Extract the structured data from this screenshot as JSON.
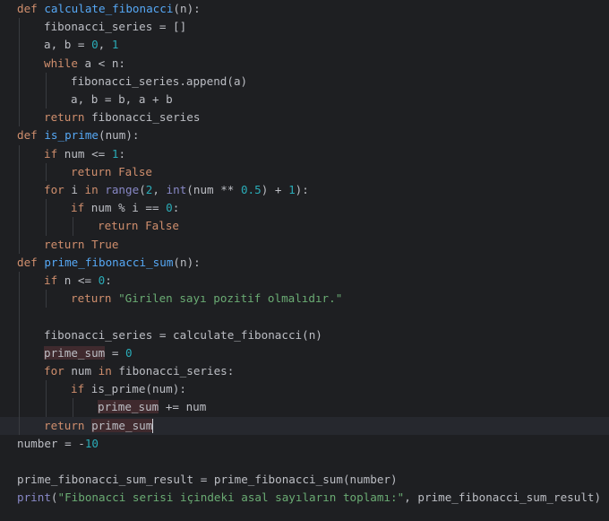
{
  "editor": {
    "lines": [
      {
        "indent": 0,
        "tokens": [
          {
            "t": "def",
            "c": "kw"
          },
          {
            "t": " "
          },
          {
            "t": "calculate_fibonacci",
            "c": "fn"
          },
          {
            "t": "(n):"
          }
        ]
      },
      {
        "indent": 1,
        "tokens": [
          {
            "t": "fibonacci_series = []"
          }
        ]
      },
      {
        "indent": 1,
        "tokens": [
          {
            "t": "a, b = "
          },
          {
            "t": "0",
            "c": "num"
          },
          {
            "t": ", "
          },
          {
            "t": "1",
            "c": "num"
          }
        ]
      },
      {
        "indent": 1,
        "tokens": [
          {
            "t": "while",
            "c": "kw"
          },
          {
            "t": " a < n:"
          }
        ]
      },
      {
        "indent": 2,
        "tokens": [
          {
            "t": "fibonacci_series.append(a)"
          }
        ]
      },
      {
        "indent": 2,
        "tokens": [
          {
            "t": "a, b = b, a + b"
          }
        ]
      },
      {
        "indent": 1,
        "tokens": [
          {
            "t": "return",
            "c": "kw"
          },
          {
            "t": " fibonacci_series"
          }
        ]
      },
      {
        "indent": 0,
        "tokens": [
          {
            "t": "def",
            "c": "kw"
          },
          {
            "t": " "
          },
          {
            "t": "is_prime",
            "c": "fn"
          },
          {
            "t": "(num):"
          }
        ]
      },
      {
        "indent": 1,
        "tokens": [
          {
            "t": "if",
            "c": "kw"
          },
          {
            "t": " num <= "
          },
          {
            "t": "1",
            "c": "num"
          },
          {
            "t": ":"
          }
        ]
      },
      {
        "indent": 2,
        "tokens": [
          {
            "t": "return",
            "c": "kw"
          },
          {
            "t": " "
          },
          {
            "t": "False",
            "c": "kw"
          }
        ]
      },
      {
        "indent": 1,
        "tokens": [
          {
            "t": "for",
            "c": "kw"
          },
          {
            "t": " i "
          },
          {
            "t": "in",
            "c": "kw"
          },
          {
            "t": " "
          },
          {
            "t": "range",
            "c": "builtin"
          },
          {
            "t": "("
          },
          {
            "t": "2",
            "c": "num"
          },
          {
            "t": ", "
          },
          {
            "t": "int",
            "c": "builtin"
          },
          {
            "t": "(num ** "
          },
          {
            "t": "0.5",
            "c": "num"
          },
          {
            "t": ") + "
          },
          {
            "t": "1",
            "c": "num"
          },
          {
            "t": "):"
          }
        ]
      },
      {
        "indent": 2,
        "tokens": [
          {
            "t": "if",
            "c": "kw"
          },
          {
            "t": " num % i == "
          },
          {
            "t": "0",
            "c": "num"
          },
          {
            "t": ":"
          }
        ]
      },
      {
        "indent": 3,
        "tokens": [
          {
            "t": "return",
            "c": "kw"
          },
          {
            "t": " "
          },
          {
            "t": "False",
            "c": "kw"
          }
        ]
      },
      {
        "indent": 1,
        "tokens": [
          {
            "t": "return",
            "c": "kw"
          },
          {
            "t": " "
          },
          {
            "t": "True",
            "c": "kw"
          }
        ]
      },
      {
        "indent": 0,
        "tokens": [
          {
            "t": "def",
            "c": "kw"
          },
          {
            "t": " "
          },
          {
            "t": "prime_fibonacci_sum",
            "c": "fn"
          },
          {
            "t": "(n):"
          }
        ]
      },
      {
        "indent": 1,
        "tokens": [
          {
            "t": "if",
            "c": "kw"
          },
          {
            "t": " n <= "
          },
          {
            "t": "0",
            "c": "num"
          },
          {
            "t": ":"
          }
        ]
      },
      {
        "indent": 2,
        "tokens": [
          {
            "t": "return",
            "c": "kw"
          },
          {
            "t": " "
          },
          {
            "t": "\"Girilen sayı pozitif olmalıdır.\"",
            "c": "str"
          }
        ]
      },
      {
        "indent": 1,
        "guides_only": true,
        "tokens": []
      },
      {
        "indent": 1,
        "tokens": [
          {
            "t": "fibonacci_series = calculate_fibonacci(n)"
          }
        ]
      },
      {
        "indent": 1,
        "tokens": [
          {
            "t": "prime_sum",
            "h": true
          },
          {
            "t": " = "
          },
          {
            "t": "0",
            "c": "num"
          }
        ]
      },
      {
        "indent": 1,
        "tokens": [
          {
            "t": "for",
            "c": "kw"
          },
          {
            "t": " num "
          },
          {
            "t": "in",
            "c": "kw"
          },
          {
            "t": " fibonacci_series:"
          }
        ]
      },
      {
        "indent": 2,
        "tokens": [
          {
            "t": "if",
            "c": "kw"
          },
          {
            "t": " is_prime(num):"
          }
        ]
      },
      {
        "indent": 3,
        "tokens": [
          {
            "t": "prime_sum",
            "h": true
          },
          {
            "t": " += num"
          }
        ]
      },
      {
        "indent": 1,
        "current": true,
        "cursor": true,
        "tokens": [
          {
            "t": "return",
            "c": "kw"
          },
          {
            "t": " "
          },
          {
            "t": "prime_sum",
            "h": true
          }
        ]
      },
      {
        "indent": 0,
        "tokens": [
          {
            "t": "number = -"
          },
          {
            "t": "10",
            "c": "num"
          }
        ]
      },
      {
        "indent": 0,
        "tokens": []
      },
      {
        "indent": 0,
        "tokens": [
          {
            "t": "prime_fibonacci_sum_result = prime_fibonacci_sum(number)"
          }
        ]
      },
      {
        "indent": 0,
        "tokens": [
          {
            "t": "print",
            "c": "builtin"
          },
          {
            "t": "("
          },
          {
            "t": "\"Fibonacci serisi içindeki asal sayıların toplamı:\"",
            "c": "str"
          },
          {
            "t": ", prime_fibonacci_sum_result)"
          }
        ]
      }
    ]
  }
}
